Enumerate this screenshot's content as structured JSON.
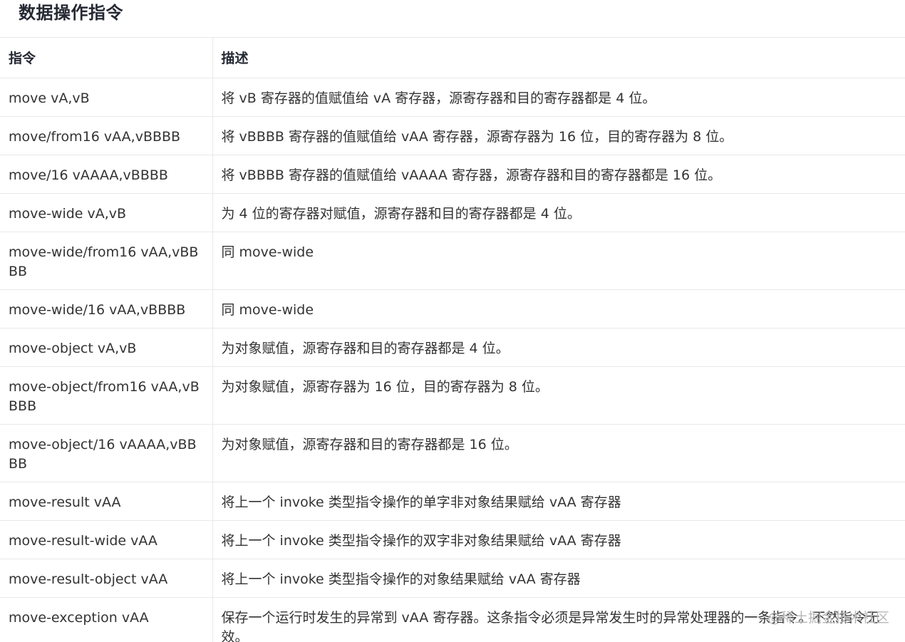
{
  "page_title": "数据操作指令",
  "table": {
    "headers": [
      "指令",
      "描述"
    ],
    "rows": [
      {
        "cmd": "move vA,vB",
        "desc": "将 vB 寄存器的值赋值给 vA 寄存器，源寄存器和目的寄存器都是 4 位。"
      },
      {
        "cmd": "move/from16 vAA,vBBBB",
        "desc": "将 vBBBB 寄存器的值赋值给 vAA 寄存器，源寄存器为 16 位，目的寄存器为 8 位。"
      },
      {
        "cmd": "move/16 vAAAA,vBBBB",
        "desc": "将 vBBBB 寄存器的值赋值给 vAAAA 寄存器，源寄存器和目的寄存器都是 16 位。"
      },
      {
        "cmd": "move-wide vA,vB",
        "desc": "为 4 位的寄存器对赋值，源寄存器和目的寄存器都是 4 位。"
      },
      {
        "cmd": "move-wide/from16 vAA,vBBBB",
        "desc": "同 move-wide"
      },
      {
        "cmd": "move-wide/16 vAA,vBBBB",
        "desc": "同 move-wide"
      },
      {
        "cmd": "move-object vA,vB",
        "desc": "为对象赋值，源寄存器和目的寄存器都是 4 位。"
      },
      {
        "cmd": "move-object/from16 vAA,vBBBB",
        "desc": "为对象赋值，源寄存器为 16 位，目的寄存器为 8 位。"
      },
      {
        "cmd": "move-object/16 vAAAA,vBBBB",
        "desc": "为对象赋值，源寄存器和目的寄存器都是 16 位。"
      },
      {
        "cmd": "move-result vAA",
        "desc": "将上一个 invoke 类型指令操作的单字非对象结果赋给 vAA 寄存器"
      },
      {
        "cmd": "move-result-wide vAA",
        "desc": "将上一个 invoke 类型指令操作的双字非对象结果赋给 vAA 寄存器"
      },
      {
        "cmd": "move-result-object vAA",
        "desc": "将上一个 invoke 类型指令操作的对象结果赋给 vAA 寄存器"
      },
      {
        "cmd": "move-exception vAA",
        "desc": "保存一个运行时发生的异常到 vAA 寄存器。这条指令必须是异常发生时的异常处理器的一条指令。不然指令无效。"
      }
    ]
  },
  "watermark": "@稀土掘金技术社区"
}
